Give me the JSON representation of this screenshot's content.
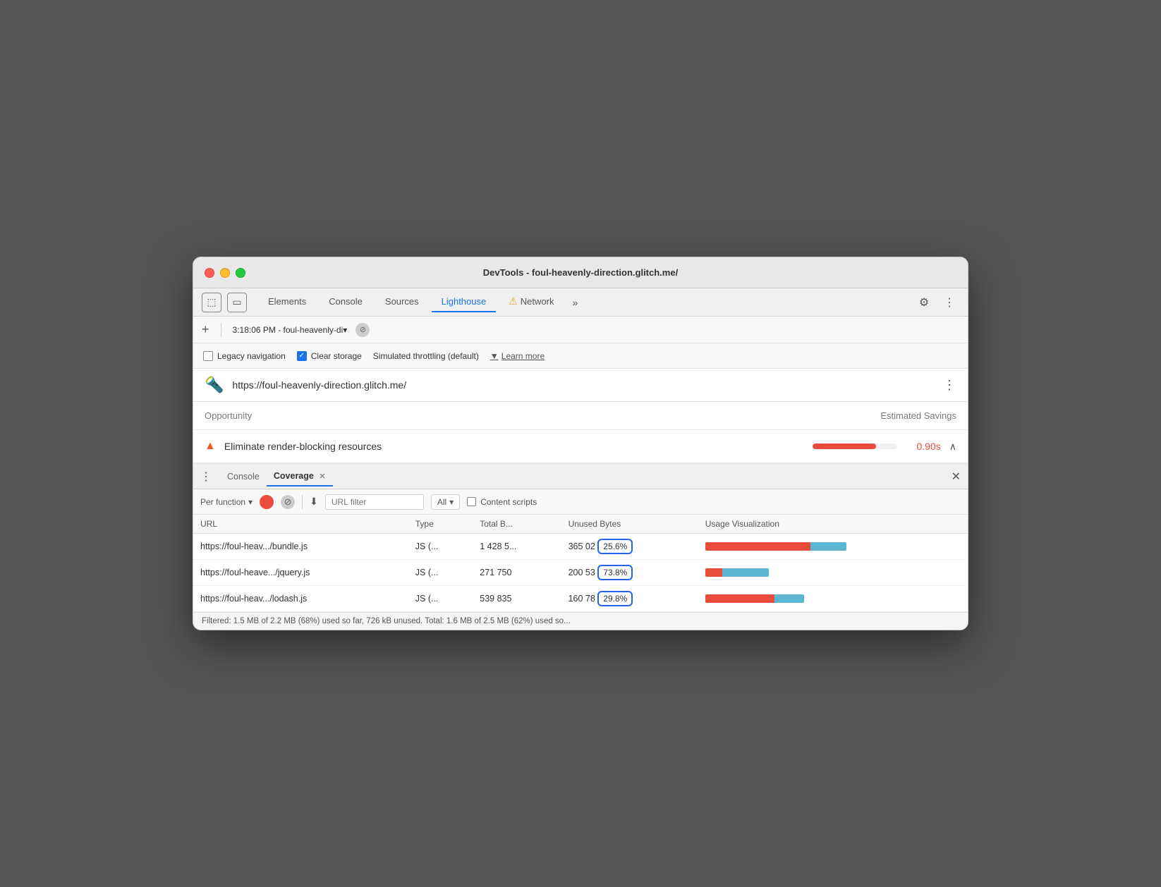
{
  "window": {
    "title": "DevTools - foul-heavenly-direction.glitch.me/"
  },
  "titlebar": {
    "title": "DevTools - foul-heavenly-direction.glitch.me/"
  },
  "tabs": {
    "items": [
      {
        "id": "elements",
        "label": "Elements",
        "active": false
      },
      {
        "id": "console",
        "label": "Console",
        "active": false
      },
      {
        "id": "sources",
        "label": "Sources",
        "active": false
      },
      {
        "id": "lighthouse",
        "label": "Lighthouse",
        "active": true
      },
      {
        "id": "network",
        "label": "Network",
        "active": false
      }
    ],
    "more_label": "»"
  },
  "toolbar": {
    "add_icon": "+",
    "time_label": "3:18:06 PM - foul-heavenly-di▾",
    "stop_icon": "⊘"
  },
  "optionsbar": {
    "legacy_nav_label": "Legacy navigation",
    "clear_storage_label": "Clear storage",
    "throttling_label": "Simulated throttling (default)",
    "dropdown_arrow": "▼",
    "learn_more_label": "Learn more"
  },
  "urlbar": {
    "logo": "🔦",
    "url": "https://foul-heavenly-direction.glitch.me/",
    "menu_icon": "⋮"
  },
  "opportunity": {
    "header_label": "Opportunity",
    "savings_label": "Estimated Savings",
    "item": {
      "title": "Eliminate render-blocking resources",
      "savings": "0.90s"
    }
  },
  "coverage_panel": {
    "menu_icon": "⋮",
    "tabs": [
      {
        "id": "console",
        "label": "Console",
        "active": false
      },
      {
        "id": "coverage",
        "label": "Coverage",
        "active": true
      }
    ],
    "close_icon": "✕",
    "toolbar": {
      "per_function_label": "Per function",
      "dropdown_arrow": "▾",
      "record_btn": "",
      "clear_btn": "⊘",
      "download_icon": "⬇",
      "url_filter_placeholder": "URL filter",
      "all_label": "All",
      "all_arrow": "▾",
      "content_scripts_label": "Content scripts"
    },
    "table": {
      "columns": [
        "URL",
        "Type",
        "Total B...",
        "Unused Bytes",
        "Usage Visualization"
      ],
      "rows": [
        {
          "url": "https://foul-heav.../bundle.js",
          "type": "JS (...",
          "total": "1 428 5...",
          "unused_raw": "365 02",
          "unused_pct": "25.6%",
          "used_ratio": 0.744,
          "bar_width_total": 200
        },
        {
          "url": "https://foul-heave.../jquery.js",
          "type": "JS (...",
          "total": "271 750",
          "unused_raw": "200 53",
          "unused_pct": "73.8%",
          "used_ratio": 0.262,
          "bar_width_total": 90
        },
        {
          "url": "https://foul-heav.../lodash.js",
          "type": "JS (...",
          "total": "539 835",
          "unused_raw": "160 78",
          "unused_pct": "29.8%",
          "used_ratio": 0.702,
          "bar_width_total": 140
        }
      ]
    },
    "statusbar": "Filtered: 1.5 MB of 2.2 MB (68%) used so far, 726 kB unused. Total: 1.6 MB of 2.5 MB (62%) used so..."
  }
}
